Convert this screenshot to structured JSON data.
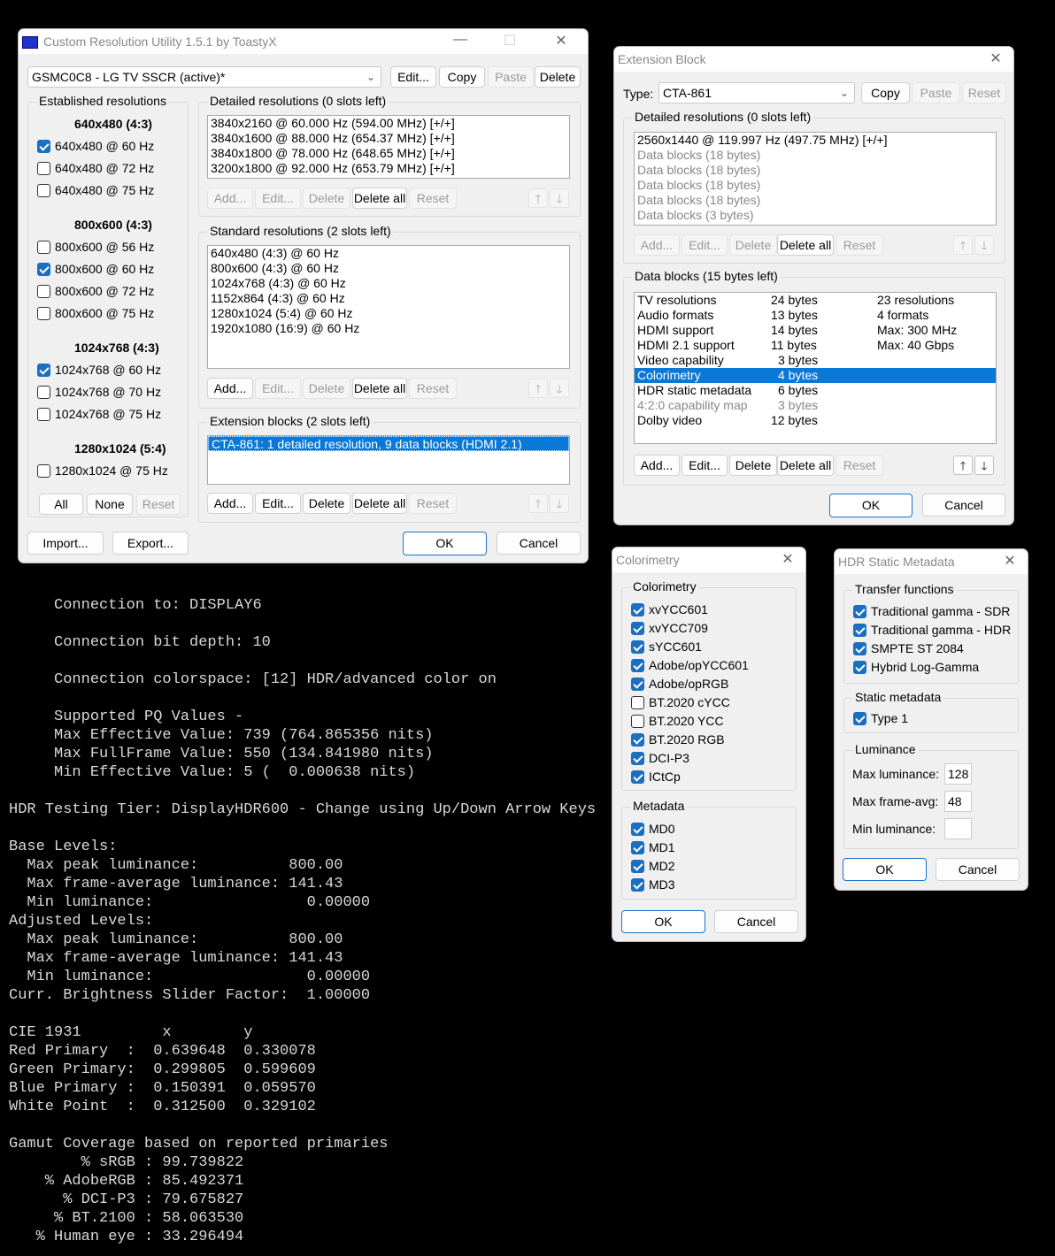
{
  "cru": {
    "title": "Custom Resolution Utility 1.5.1 by ToastyX",
    "display_select": "GSMC0C8 - LG TV SSCR (active)*",
    "top_buttons": {
      "edit": "Edit...",
      "copy": "Copy",
      "paste": "Paste",
      "delete": "Delete"
    },
    "established": {
      "label": "Established resolutions",
      "groups": [
        {
          "heading": "640x480 (4:3)",
          "items": [
            {
              "label": "640x480 @ 60 Hz",
              "checked": true
            },
            {
              "label": "640x480 @ 72 Hz",
              "checked": false
            },
            {
              "label": "640x480 @ 75 Hz",
              "checked": false
            }
          ]
        },
        {
          "heading": "800x600 (4:3)",
          "items": [
            {
              "label": "800x600 @ 56 Hz",
              "checked": false
            },
            {
              "label": "800x600 @ 60 Hz",
              "checked": true
            },
            {
              "label": "800x600 @ 72 Hz",
              "checked": false
            },
            {
              "label": "800x600 @ 75 Hz",
              "checked": false
            }
          ]
        },
        {
          "heading": "1024x768 (4:3)",
          "items": [
            {
              "label": "1024x768 @ 60 Hz",
              "checked": true
            },
            {
              "label": "1024x768 @ 70 Hz",
              "checked": false
            },
            {
              "label": "1024x768 @ 75 Hz",
              "checked": false
            }
          ]
        },
        {
          "heading": "1280x1024 (5:4)",
          "items": [
            {
              "label": "1280x1024 @ 75 Hz",
              "checked": false
            }
          ]
        }
      ],
      "buttons": {
        "all": "All",
        "none": "None",
        "reset": "Reset"
      }
    },
    "detailed": {
      "label": "Detailed resolutions (0 slots left)",
      "items": [
        "3840x2160 @ 60.000 Hz (594.00 MHz) [+/+]",
        "3840x1600 @ 88.000 Hz (654.37 MHz) [+/+]",
        "3840x1800 @ 78.000 Hz (648.65 MHz) [+/+]",
        "3200x1800 @ 92.000 Hz (653.79 MHz) [+/+]"
      ]
    },
    "standard": {
      "label": "Standard resolutions (2 slots left)",
      "items": [
        "640x480 (4:3) @ 60 Hz",
        "800x600 (4:3) @ 60 Hz",
        "1024x768 (4:3) @ 60 Hz",
        "1152x864 (4:3) @ 60 Hz",
        "1280x1024 (5:4) @ 60 Hz",
        "1920x1080 (16:9) @ 60 Hz"
      ]
    },
    "extension": {
      "label": "Extension blocks (2 slots left)",
      "items": [
        "CTA-861: 1 detailed resolution, 9 data blocks (HDMI 2.1)"
      ]
    },
    "list_buttons": {
      "add": "Add...",
      "edit": "Edit...",
      "delete": "Delete",
      "delete_all": "Delete all",
      "reset": "Reset"
    },
    "arrows": {
      "up": "🡑",
      "down": "🡓"
    },
    "bottom": {
      "import": "Import...",
      "export": "Export...",
      "ok": "OK",
      "cancel": "Cancel"
    }
  },
  "ext": {
    "title": "Extension Block",
    "type_label": "Type:",
    "type_value": "CTA-861",
    "copy": "Copy",
    "paste": "Paste",
    "reset": "Reset",
    "detailed_label": "Detailed resolutions (0 slots left)",
    "detailed_items": [
      {
        "text": "2560x1440 @ 119.997 Hz (497.75 MHz) [+/+]",
        "gray": false
      },
      {
        "text": "Data blocks (18 bytes)",
        "gray": true
      },
      {
        "text": "Data blocks (18 bytes)",
        "gray": true
      },
      {
        "text": "Data blocks (18 bytes)",
        "gray": true
      },
      {
        "text": "Data blocks (18 bytes)",
        "gray": true
      },
      {
        "text": "Data blocks (3 bytes)",
        "gray": true
      }
    ],
    "datablocks_label": "Data blocks (15 bytes left)",
    "datablocks": [
      {
        "name": "TV resolutions",
        "size": "24 bytes",
        "info": "23 resolutions"
      },
      {
        "name": "Audio formats",
        "size": "13 bytes",
        "info": "4 formats"
      },
      {
        "name": "HDMI support",
        "size": "14 bytes",
        "info": "Max: 300 MHz"
      },
      {
        "name": "HDMI 2.1 support",
        "size": "11 bytes",
        "info": "Max: 40 Gbps"
      },
      {
        "name": "Video capability",
        "size": "3 bytes",
        "info": ""
      },
      {
        "name": "Colorimetry",
        "size": "4 bytes",
        "info": ""
      },
      {
        "name": "HDR static metadata",
        "size": "6 bytes",
        "info": ""
      },
      {
        "name": "4:2:0 capability map",
        "size": "3 bytes",
        "info": ""
      },
      {
        "name": "Dolby video",
        "size": "12 bytes",
        "info": ""
      }
    ],
    "ok": "OK",
    "cancel": "Cancel"
  },
  "color": {
    "title": "Colorimetry",
    "group1": "Colorimetry",
    "items": [
      {
        "label": "xvYCC601",
        "checked": true
      },
      {
        "label": "xvYCC709",
        "checked": true
      },
      {
        "label": "sYCC601",
        "checked": true
      },
      {
        "label": "Adobe/opYCC601",
        "checked": true
      },
      {
        "label": "Adobe/opRGB",
        "checked": true
      },
      {
        "label": "BT.2020 cYCC",
        "checked": false
      },
      {
        "label": "BT.2020 YCC",
        "checked": false
      },
      {
        "label": "BT.2020 RGB",
        "checked": true
      },
      {
        "label": "DCI-P3",
        "checked": true
      },
      {
        "label": "ICtCp",
        "checked": true
      }
    ],
    "group2": "Metadata",
    "meta": [
      {
        "label": "MD0",
        "checked": true
      },
      {
        "label": "MD1",
        "checked": true
      },
      {
        "label": "MD2",
        "checked": true
      },
      {
        "label": "MD3",
        "checked": true
      }
    ],
    "ok": "OK",
    "cancel": "Cancel"
  },
  "hdr": {
    "title": "HDR Static Metadata",
    "transfer_label": "Transfer functions",
    "transfer": [
      {
        "label": "Traditional gamma - SDR",
        "checked": true
      },
      {
        "label": "Traditional gamma - HDR",
        "checked": true
      },
      {
        "label": "SMPTE ST 2084",
        "checked": true
      },
      {
        "label": "Hybrid Log-Gamma",
        "checked": true
      }
    ],
    "static_label": "Static metadata",
    "static": [
      {
        "label": "Type 1",
        "checked": true
      }
    ],
    "lum_label": "Luminance",
    "max_lum_label": "Max luminance:",
    "max_lum": "128",
    "max_avg_label": "Max frame-avg:",
    "max_avg": "48",
    "min_lum_label": "Min luminance:",
    "min_lum": "",
    "ok": "OK",
    "cancel": "Cancel"
  },
  "console": {
    "lines": [
      "     Connection to: DISPLAY6",
      "",
      "     Connection bit depth: 10",
      "",
      "     Connection colorspace: [12] HDR/advanced color on",
      "",
      "     Supported PQ Values -",
      "     Max Effective Value: 739 (764.865356 nits)",
      "     Max FullFrame Value: 550 (134.841980 nits)",
      "     Min Effective Value: 5 (  0.000638 nits)",
      "",
      "HDR Testing Tier: DisplayHDR600 - Change using Up/Down Arrow Keys",
      "",
      "Base Levels:",
      "  Max peak luminance:          800.00",
      "  Max frame-average luminance: 141.43",
      "  Min luminance:                 0.00000",
      "Adjusted Levels:",
      "  Max peak luminance:          800.00",
      "  Max frame-average luminance: 141.43",
      "  Min luminance:                 0.00000",
      "Curr. Brightness Slider Factor:  1.00000",
      "",
      "CIE 1931         x        y",
      "Red Primary  :  0.639648  0.330078",
      "Green Primary:  0.299805  0.599609",
      "Blue Primary :  0.150391  0.059570",
      "White Point  :  0.312500  0.329102",
      "",
      "Gamut Coverage based on reported primaries",
      "        % sRGB : 99.739822",
      "    % AdobeRGB : 85.492371",
      "      % DCI-P3 : 79.675827",
      "     % BT.2100 : 58.063530",
      "   % Human eye : 33.296494"
    ]
  }
}
